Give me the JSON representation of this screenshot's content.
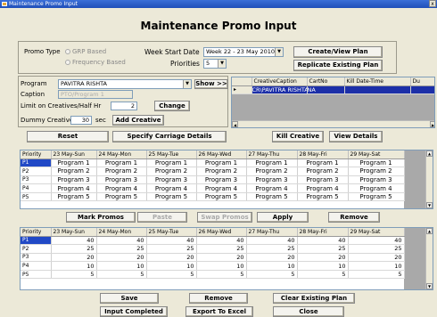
{
  "window": {
    "title": "Maintenance Promo Input",
    "close": "x"
  },
  "heading": "Maintenance Promo Input",
  "top": {
    "promo_type_label": "Promo Type",
    "radio_grp": "GRP Based",
    "radio_freq": "Frequency Based",
    "week_start_label": "Week Start Date",
    "week_start_value": "Week 22 - 23 May 2010",
    "priorities_label": "Priorities",
    "priorities_value": "5",
    "create_view_plan": "Create/View Plan",
    "replicate_plan": "Replicate Existing Plan"
  },
  "left": {
    "program_label": "Program",
    "program_value": "PAVITRA RISHTA",
    "show_btn": "Show >>",
    "caption_label": "Caption",
    "caption_value": "PTO/Program 1",
    "limit_label": "Limit on Creatives/Half Hr",
    "limit_value": "2",
    "change_btn": "Change",
    "dummy_label": "Dummy Creative",
    "dummy_value": "30",
    "sec_label": "sec",
    "add_creative_btn": "Add Creative",
    "reset_btn": "Reset",
    "carriage_btn": "Specify Carriage Details"
  },
  "creative_grid": {
    "headers": [
      "CreativeCaption",
      "CartNo",
      "Kill Date-Time",
      "Du"
    ],
    "rows": [
      [
        "CR\\PAVITRA RISHTA",
        "NA",
        "",
        ""
      ]
    ]
  },
  "right_buttons": {
    "kill": "Kill Creative",
    "view": "View Details"
  },
  "program_grid": {
    "headers": [
      "Priority",
      "23 May-Sun",
      "24 May-Mon",
      "25 May-Tue",
      "26 May-Wed",
      "27 May-Thu",
      "28 May-Fri",
      "29 May-Sat"
    ],
    "rows": [
      [
        "P1",
        "Program 1",
        "Program 1",
        "Program 1",
        "Program 1",
        "Program 1",
        "Program 1",
        "Program 1"
      ],
      [
        "P2",
        "Program 2",
        "Program 2",
        "Program 2",
        "Program 2",
        "Program 2",
        "Program 2",
        "Program 2"
      ],
      [
        "P3",
        "Program 3",
        "Program 3",
        "Program 3",
        "Program 3",
        "Program 3",
        "Program 3",
        "Program 3"
      ],
      [
        "P4",
        "Program 4",
        "Program 4",
        "Program 4",
        "Program 4",
        "Program 4",
        "Program 4",
        "Program 4"
      ],
      [
        "P5",
        "Program 5",
        "Program 5",
        "Program 5",
        "Program 5",
        "Program 5",
        "Program 5",
        "Program 5"
      ]
    ]
  },
  "mid_buttons": {
    "mark": "Mark Promos",
    "paste": "Paste",
    "swap": "Swap Promos",
    "apply": "Apply",
    "remove": "Remove"
  },
  "value_grid": {
    "headers": [
      "Priority",
      "23 May-Sun",
      "24 May-Mon",
      "25 May-Tue",
      "26 May-Wed",
      "27 May-Thu",
      "28 May-Fri",
      "29 May-Sat"
    ],
    "rows": [
      [
        "P1",
        "40",
        "40",
        "40",
        "40",
        "40",
        "40",
        "40"
      ],
      [
        "P2",
        "25",
        "25",
        "25",
        "25",
        "25",
        "25",
        "25"
      ],
      [
        "P3",
        "20",
        "20",
        "20",
        "20",
        "20",
        "20",
        "20"
      ],
      [
        "P4",
        "10",
        "10",
        "10",
        "10",
        "10",
        "10",
        "10"
      ],
      [
        "P5",
        "5",
        "5",
        "5",
        "5",
        "5",
        "5",
        "5"
      ]
    ]
  },
  "bottom_buttons": {
    "save": "Save",
    "remove": "Remove",
    "clear": "Clear Existing Plan"
  },
  "footer_buttons": {
    "input_completed": "Input Completed",
    "export": "Export To Excel",
    "close": "Close"
  }
}
